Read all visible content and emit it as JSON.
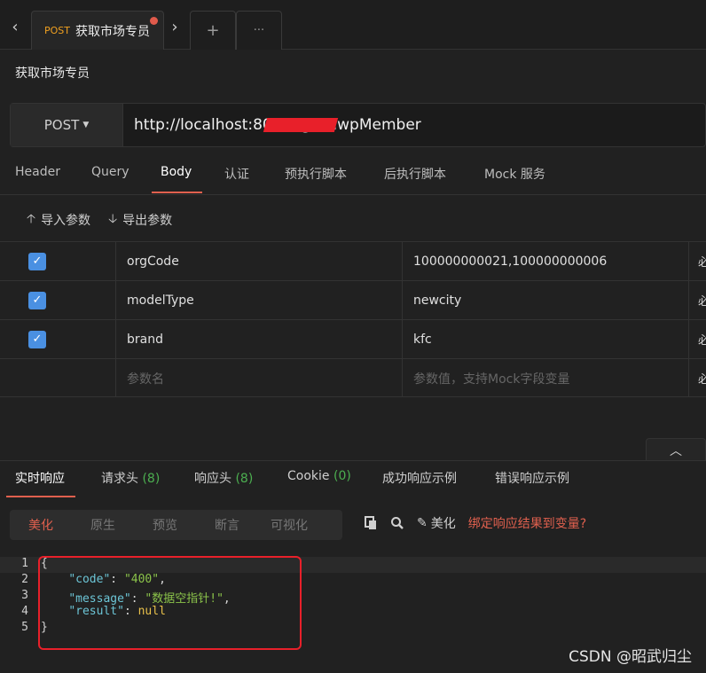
{
  "tabbar": {
    "back_icon": "‹",
    "forward_icon": "›",
    "active_tab": {
      "method": "POST",
      "title": "获取市场专员"
    },
    "add_icon": "+",
    "more_icon": "···"
  },
  "page": {
    "title": "获取市场专员"
  },
  "request": {
    "method": "POST",
    "url": "http://localhost:8081/        getNwpMember"
  },
  "subtabs": [
    "Header",
    "Query",
    "Body",
    "认证",
    "预执行脚本",
    "后执行脚本",
    "Mock 服务"
  ],
  "active_subtab": "Body",
  "param_actions": {
    "import": "导入参数",
    "export": "导出参数"
  },
  "params": [
    {
      "checked": true,
      "name": "orgCode",
      "value": "100000000021,100000000006",
      "req": "必"
    },
    {
      "checked": true,
      "name": "modelType",
      "value": "newcity",
      "req": "必"
    },
    {
      "checked": true,
      "name": "brand",
      "value": "kfc",
      "req": "必"
    }
  ],
  "param_placeholder": {
    "name": "参数名",
    "value": "参数值，支持Mock字段变量",
    "req": "必"
  },
  "response_tabs": [
    {
      "label": "实时响应",
      "count": ""
    },
    {
      "label": "请求头",
      "count": "(8)"
    },
    {
      "label": "响应头",
      "count": "(8)"
    },
    {
      "label": "Cookie",
      "count": "(0)"
    },
    {
      "label": "成功响应示例",
      "count": ""
    },
    {
      "label": "错误响应示例",
      "count": ""
    }
  ],
  "response_toolbar": {
    "buttons": [
      "美化",
      "原生",
      "预览",
      "断言",
      "可视化"
    ],
    "active": "美化",
    "beautify_label": "美化",
    "bind_label": "绑定响应结果到变量?"
  },
  "response_body": {
    "lines": [
      "1",
      "2",
      "3",
      "4",
      "5"
    ],
    "code_key": "\"code\"",
    "code_val": "\"400\"",
    "message_key": "\"message\"",
    "message_val": "\"数据空指针!\"",
    "result_key": "\"result\"",
    "result_val": "null"
  },
  "watermark": "CSDN @昭武归尘",
  "colors": {
    "accent": "#e0604e",
    "checkbox": "#4a90e2",
    "method": "#f0a020"
  }
}
